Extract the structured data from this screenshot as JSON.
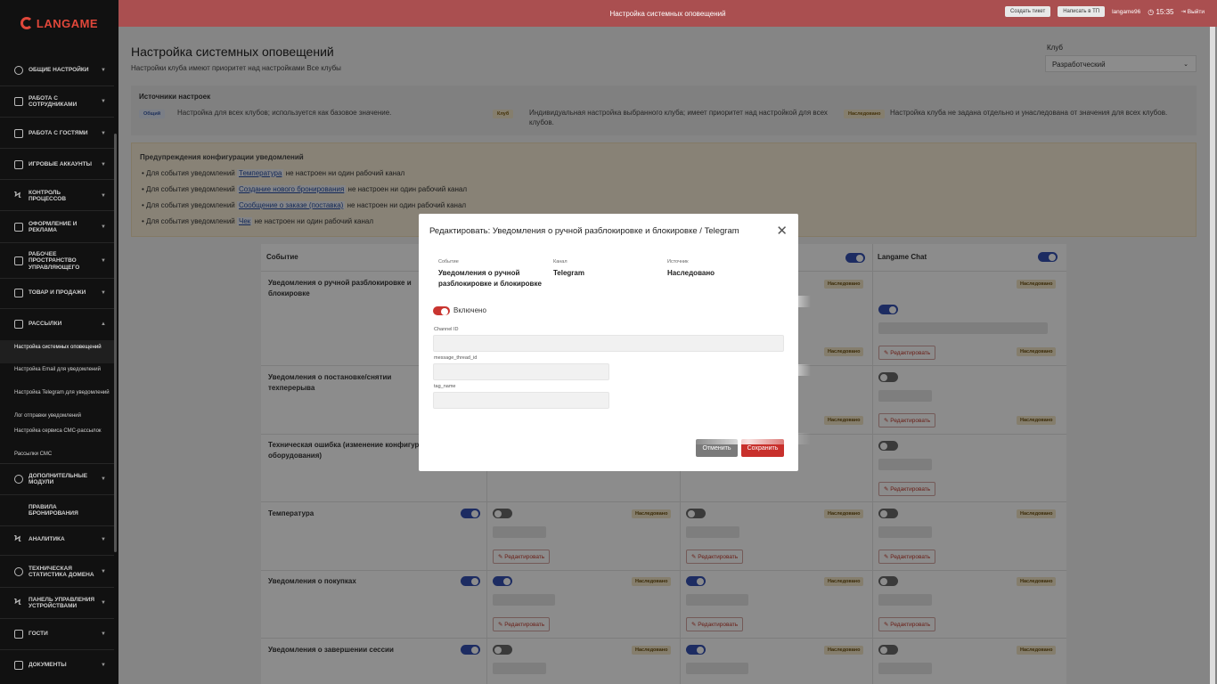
{
  "brand": {
    "name": "LANGAME",
    "accent": "#e0473a"
  },
  "topbar": {
    "title": "Настройка системных оповещений",
    "create_ticket": "Создать тикет",
    "write_support": "Написать в ТП",
    "user": "langame96",
    "time": "15:35",
    "logout": "Выйти",
    "color": "#c0282a"
  },
  "sidebar": {
    "groups": [
      {
        "label": "ОБЩИЕ НАСТРОЙКИ",
        "icon": "gear-icon"
      },
      {
        "label": "РАБОТА С СОТРУДНИКАМИ",
        "icon": "users-icon"
      },
      {
        "label": "РАБОТА С ГОСТЯМИ",
        "icon": "guests-icon"
      },
      {
        "label": "ИГРОВЫЕ АККАУНТЫ",
        "icon": "account-icon"
      },
      {
        "label": "КОНТРОЛЬ ПРОЦЕССОВ",
        "icon": "bolt-icon"
      },
      {
        "label": "ОФОРМЛЕНИЕ И РЕКЛАМА",
        "icon": "edit-icon"
      },
      {
        "label": "РАБОЧЕЕ ПРОСТРАНСТВО УПРАВЛЯЮЩЕГО",
        "icon": "briefcase-icon"
      },
      {
        "label": "ТОВАР И ПРОДАЖИ",
        "icon": "goods-icon"
      },
      {
        "label": "РАССЫЛКИ",
        "icon": "mail-icon"
      },
      {
        "label": "ДОПОЛНИТЕЛЬНЫЕ МОДУЛИ",
        "icon": "modules-icon"
      },
      {
        "label": "ПРАВИЛА БРОНИРОВАНИЯ",
        "icon": ""
      },
      {
        "label": "АНАЛИТИКА",
        "icon": "analytics-icon"
      },
      {
        "label": "ТЕХНИЧЕСКАЯ СТАТИСТИКА ДОМЕНА",
        "icon": "pie-icon"
      },
      {
        "label": "ПАНЕЛЬ УПРАВЛЕНИЯ УСТРОЙСТВАМИ",
        "icon": "devices-icon"
      },
      {
        "label": "ГОСТИ",
        "icon": "guest-icon"
      },
      {
        "label": "ДОКУМЕНТЫ",
        "icon": "docs-icon"
      }
    ],
    "subitems": [
      "Настройка системных оповещений",
      "Настройка Email для уведомлений",
      "Настройка Telegram для уведомлений",
      "Лог отправки уведомлений",
      "Настройка сервиса СМС-рассылок",
      "Рассылки СМС"
    ]
  },
  "page": {
    "title": "Настройка системных оповещений",
    "subtitle": "Настройки клуба имеют приоритет над настройками Все клубы",
    "club_label": "Клуб",
    "club_value": "Разработческий"
  },
  "sources": {
    "title": "Источники настроек",
    "items": [
      {
        "badge": "Общий",
        "text": "Настройка для всех клубов; используется как базовое значение."
      },
      {
        "badge": "Клуб",
        "text": "Индивидуальная настройка выбранного клуба; имеет приоритет над настройкой для всех клубов."
      },
      {
        "badge": "Наследовано",
        "text": "Настройка клуба не задана отдельно и унаследована от значения для всех клубов."
      }
    ]
  },
  "warnings": {
    "title": "Предупреждения конфигурации уведомлений",
    "prefix": "Для события уведомлений",
    "suffix": "не настроен ни один рабочий канал",
    "items": [
      "Температура",
      "Создание нового бронирования",
      "Сообщение о заказе (поставка)",
      "Чек"
    ]
  },
  "table": {
    "col_event": "Событие",
    "col_langame": "Langame Chat",
    "badge": "Наследовано",
    "edit": "Редактировать",
    "rows": [
      "Уведомления о ручной разблокировке и блокировке",
      "Уведомления о постановке/снятии техперерыва",
      "Техническая ошибка (изменение конфигурации оборудования)",
      "Температура",
      "Уведомления о покупках",
      "Уведомления о завершении сессии"
    ]
  },
  "modal": {
    "title": "Редактировать: Уведомления о ручной разблокировке и блокировке / Telegram",
    "event_label": "Событие",
    "event_value": "Уведомления о ручной разблокировке и блокировке",
    "channel_label": "Канал",
    "channel_value": "Telegram",
    "source_label": "Источник",
    "source_value": "Наследовано",
    "enabled": "Включено",
    "field1": "Channel ID",
    "field2": "message_thread_id",
    "field3": "tag_name",
    "cancel": "Отменить",
    "save": "Сохранить"
  }
}
